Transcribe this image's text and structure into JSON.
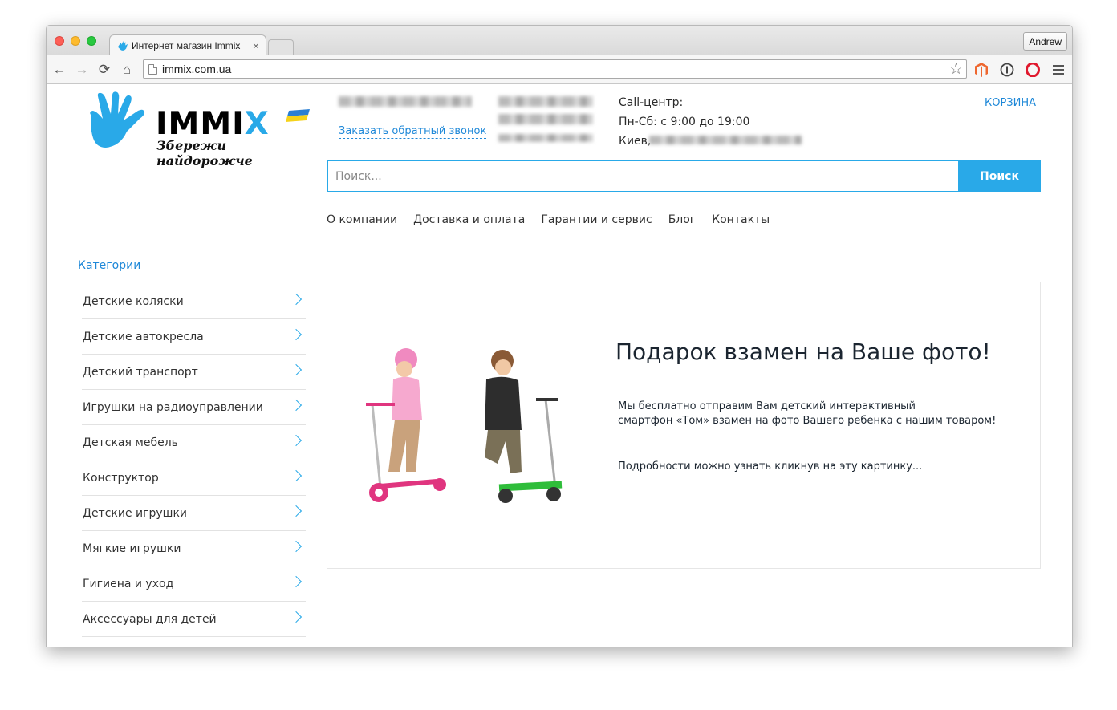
{
  "browser": {
    "tab_title": "Интернет магазин Immix",
    "tab_close": "×",
    "profile_name": "Andrew",
    "url": "immix.com.ua",
    "nav": {
      "back": "←",
      "forward": "→",
      "reload": "⟳",
      "home": "⌂"
    },
    "star": "☆",
    "extensions": [
      "magento-icon",
      "1password-icon",
      "opera-icon",
      "menu-icon"
    ]
  },
  "header": {
    "logo_word_main": "IMMI",
    "logo_word_x": "X",
    "logo_tagline": "Збережи найдорожче",
    "callback_link": "Заказать обратный звонок",
    "callcenter_title": "Call-центр:",
    "callcenter_hours": "Пн-Сб: с 9:00 до 19:00",
    "callcenter_city": "Киев,",
    "cart_link": "КОРЗИНА"
  },
  "search": {
    "placeholder": "Поиск...",
    "button_label": "Поиск"
  },
  "topnav": [
    "О компании",
    "Доставка и оплата",
    "Гарантии и сервис",
    "Блог",
    "Контакты"
  ],
  "sidebar": {
    "title": "Категории",
    "items": [
      "Детские коляски",
      "Детские автокресла",
      "Детский транспорт",
      "Игрушки на радиоуправлении",
      "Детская мебель",
      "Конструктор",
      "Детские игрушки",
      "Мягкие игрушки",
      "Гигиена и уход",
      "Аксессуары для детей"
    ]
  },
  "banner": {
    "title": "Подарок взамен на Ваше фото!",
    "text_line1": "Мы бесплатно отправим Вам детский интерактивный",
    "text_line2": "смартфон «Том» взамен на фото Вашего ребенка с нашим товаром!",
    "more": "Подробности можно узнать кликнув на эту картинку..."
  },
  "colors": {
    "accent": "#29a9e8",
    "link": "#1e88d8",
    "text": "#333333"
  }
}
